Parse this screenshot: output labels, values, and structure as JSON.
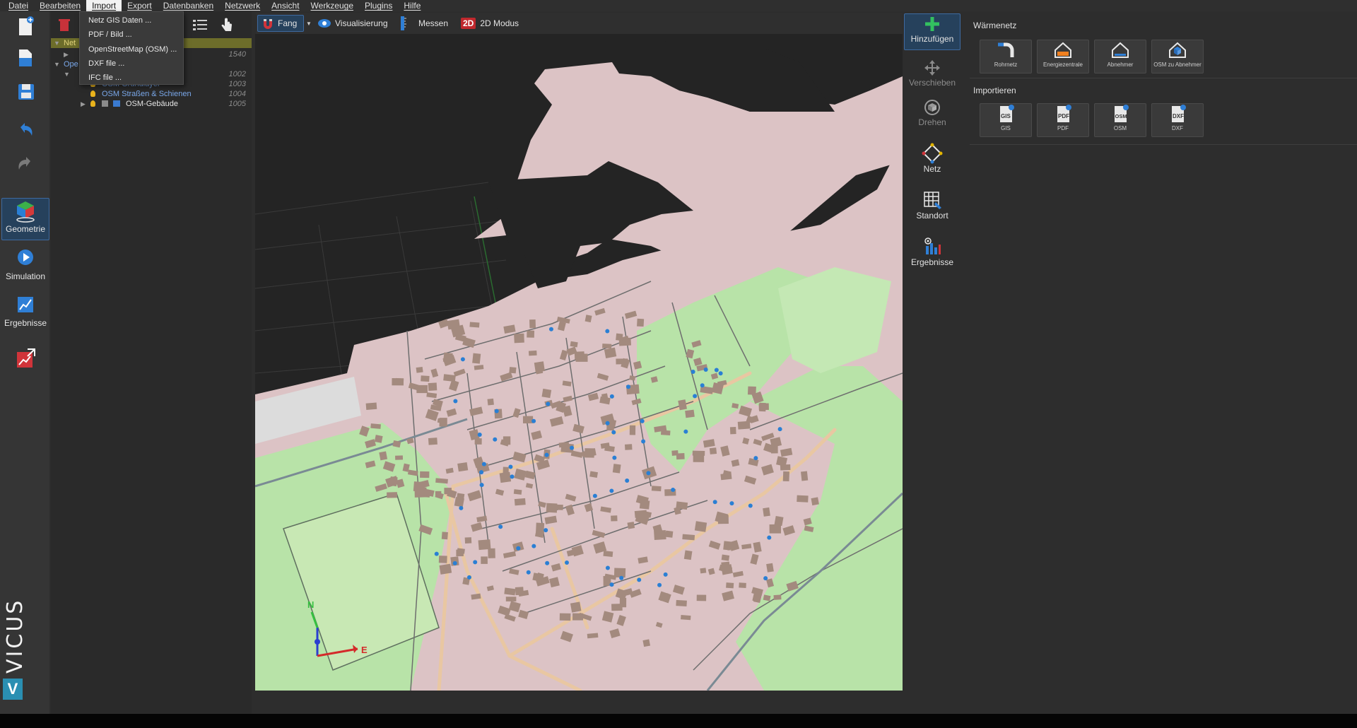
{
  "menubar": {
    "items": [
      {
        "label": "Datei",
        "active": false
      },
      {
        "label": "Bearbeiten",
        "active": false
      },
      {
        "label": "Import",
        "active": true
      },
      {
        "label": "Export",
        "active": false
      },
      {
        "label": "Datenbanken",
        "active": false
      },
      {
        "label": "Netzwerk",
        "active": false
      },
      {
        "label": "Ansicht",
        "active": false
      },
      {
        "label": "Werkzeuge",
        "active": false
      },
      {
        "label": "Plugins",
        "active": false
      },
      {
        "label": "Hilfe",
        "active": false
      }
    ]
  },
  "import_menu": {
    "items": [
      "Netz GIS Daten ...",
      "PDF / Bild ...",
      "OpenStreetMap (OSM) ...",
      "DXF file ...",
      "IFC file ..."
    ]
  },
  "left_toolbar": {
    "geometry_label": "Geometrie",
    "simulation_label": "Simulation",
    "results_label": "Ergebnisse",
    "brand": "VICUS"
  },
  "tree": {
    "rows": [
      {
        "label": "Net",
        "num": "",
        "highlight": true
      },
      {
        "label": "",
        "num": "1540"
      },
      {
        "label": "Ope",
        "num": ""
      },
      {
        "label": "",
        "num": "1002"
      },
      {
        "label": "OSM Grundlayer",
        "num": "1003"
      },
      {
        "label": "OSM Straßen & Schienen",
        "num": "1004"
      },
      {
        "label": "OSM-Gebäude",
        "num": "1005"
      }
    ]
  },
  "viewport_toolbar": {
    "snap_label": "Fang",
    "visualization_label": "Visualisierung",
    "measure_label": "Messen",
    "mode_badge": "2D",
    "mode_label": "2D Modus"
  },
  "tool_column": {
    "add_label": "Hinzufügen",
    "move_label": "Verschieben",
    "rotate_label": "Drehen",
    "network_label": "Netz",
    "location_label": "Standort",
    "results_label": "Ergebnisse"
  },
  "properties": {
    "section1_title": "Wärmenetz",
    "section1_tiles": [
      "Rohrnetz",
      "Energiezentrale",
      "Abnehmer",
      "OSM zu Abnehmer"
    ],
    "section2_title": "Importieren",
    "section2_tiles": [
      "GIS",
      "PDF",
      "OSM",
      "DXF"
    ],
    "section2_glyphs": [
      "GIS",
      "PDF",
      "OSM",
      "DXF"
    ]
  },
  "axis": {
    "north": "N",
    "east": "E"
  },
  "colors": {
    "accent": "#3e6aa0",
    "map_pink": "#dcc3c5",
    "map_green": "#b5e0a6",
    "building": "#a38a7e",
    "road_major": "#ecc7a4",
    "consumer_dot": "#2a7fd4"
  }
}
